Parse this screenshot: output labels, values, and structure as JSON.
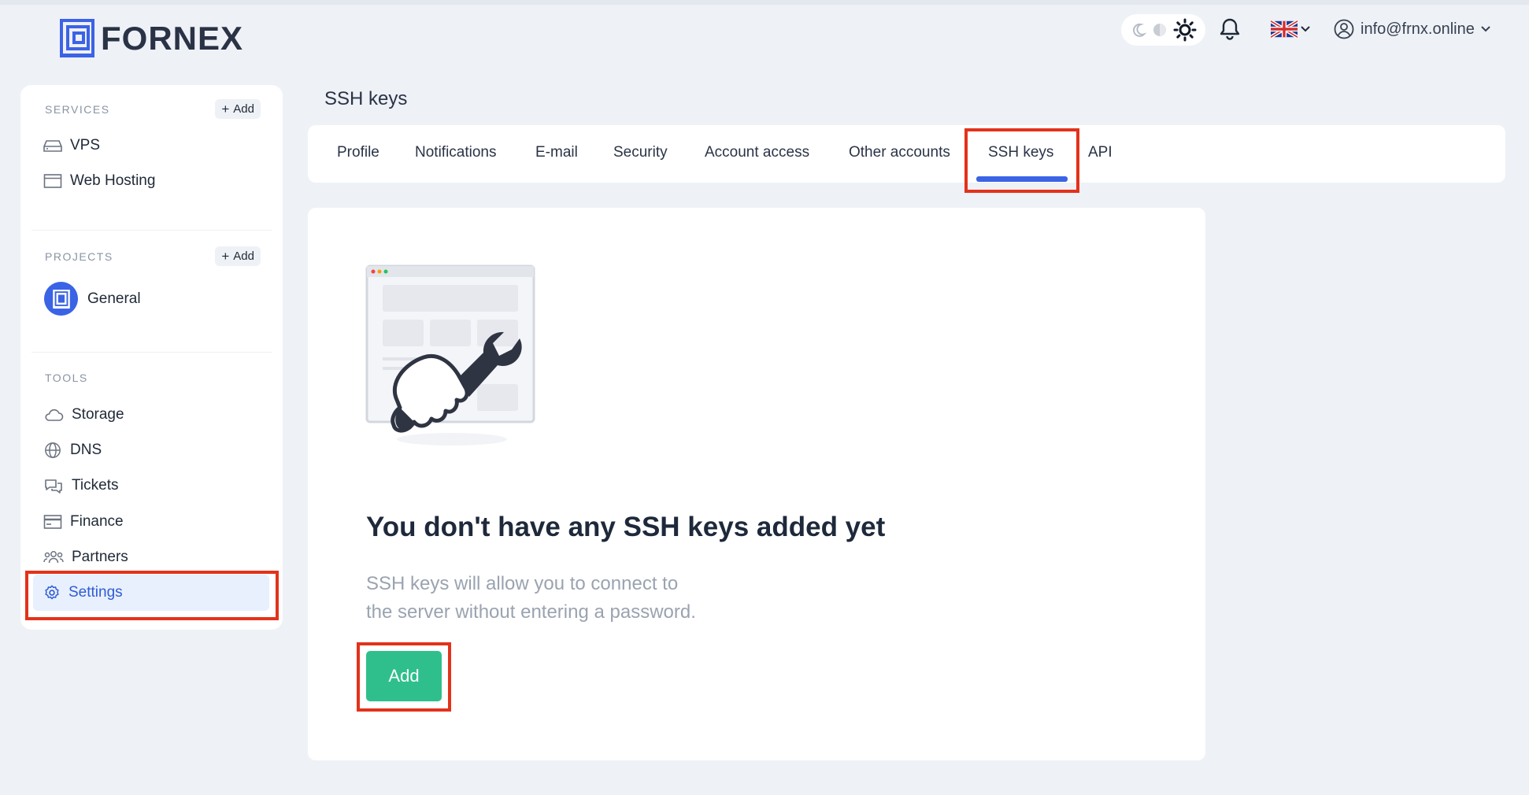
{
  "brand": {
    "name": "FORNEX"
  },
  "header": {
    "theme_icons": [
      "moon-icon",
      "auto-icon",
      "sun-icon"
    ],
    "notifications_icon": "bell-icon",
    "language_flag": "uk-flag-icon",
    "user_email": "info@frnx.online"
  },
  "sidebar": {
    "services": {
      "title": "SERVICES",
      "add_label": "Add",
      "items": [
        {
          "label": "VPS",
          "icon": "server-icon"
        },
        {
          "label": "Web Hosting",
          "icon": "browser-icon"
        }
      ]
    },
    "projects": {
      "title": "PROJECTS",
      "add_label": "Add",
      "items": [
        {
          "label": "General",
          "icon": "project-logo-icon"
        }
      ]
    },
    "tools": {
      "title": "TOOLS",
      "items": [
        {
          "label": "Storage",
          "icon": "cloud-icon"
        },
        {
          "label": "DNS",
          "icon": "globe-icon"
        },
        {
          "label": "Tickets",
          "icon": "chat-icon"
        },
        {
          "label": "Finance",
          "icon": "card-icon"
        },
        {
          "label": "Partners",
          "icon": "users-icon"
        },
        {
          "label": "Settings",
          "icon": "gear-icon",
          "active": true
        }
      ]
    }
  },
  "main": {
    "page_title": "SSH keys",
    "tabs": [
      {
        "label": "Profile"
      },
      {
        "label": "Notifications"
      },
      {
        "label": "E-mail"
      },
      {
        "label": "Security"
      },
      {
        "label": "Account access"
      },
      {
        "label": "Other accounts"
      },
      {
        "label": "SSH keys",
        "active": true
      },
      {
        "label": "API"
      }
    ],
    "empty_state": {
      "title": "You don't have any SSH keys added yet",
      "description_line1": "SSH keys will allow you to connect to",
      "description_line2": "the server without entering a password.",
      "button_label": "Add"
    }
  },
  "colors": {
    "accent": "#3b63e6",
    "success_button": "#2fbf8d",
    "highlight": "#e3321b",
    "background": "#eef1f6"
  }
}
